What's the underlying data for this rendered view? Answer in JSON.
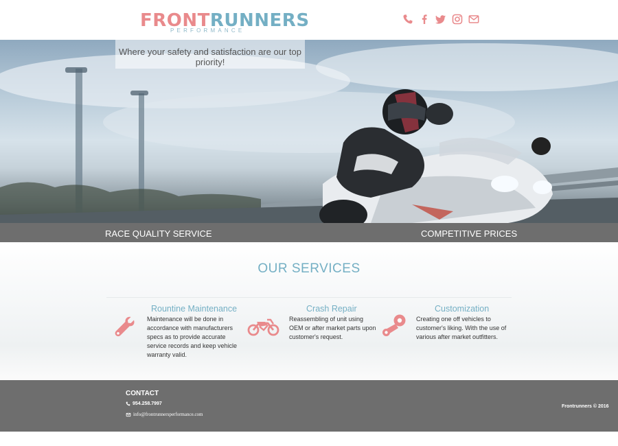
{
  "header": {
    "logo_front": "FRONT",
    "logo_runners": "RUNNERS",
    "logo_sub": "PERFORMANCE",
    "social_icons": [
      "phone-icon",
      "facebook-icon",
      "twitter-icon",
      "instagram-icon",
      "envelope-icon"
    ]
  },
  "hero": {
    "tagline": "Where your safety and satisfaction are our top priority!"
  },
  "band": {
    "left_label": "RACE QUALITY SERVICE",
    "right_label": "COMPETITIVE PRICES"
  },
  "services": {
    "title": "OUR SERVICES",
    "items": [
      {
        "title": "Rountine Maintenance",
        "text": "Maintenance will be done in accordance with manufacturers specs as to provide accurate service records and keep vehicle warranty valid.",
        "icon": "wrench-icon"
      },
      {
        "title": "Crash Repair",
        "text": "Reassembling of unit using OEM or after market parts upon customer's request.",
        "icon": "motorcycle-icon"
      },
      {
        "title": "Customization",
        "text": "Creating one off vehicles to customer's liking. With the use of various after market outfitters.",
        "icon": "piston-icon"
      }
    ]
  },
  "footer": {
    "contact_heading": "CONTACT",
    "phone": "954.258.7997",
    "email": "info@frontrunnersperformance.com",
    "copyright": "Frontrunners © 2016"
  },
  "colors": {
    "accent_pink": "#e98a8c",
    "accent_blue": "#74afc4",
    "band_gray": "#6e6e6e"
  }
}
